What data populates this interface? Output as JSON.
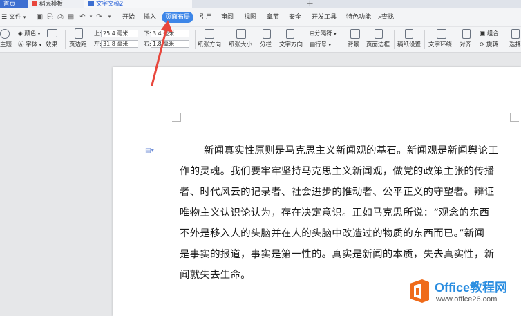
{
  "titlebar": {
    "tabs": [
      {
        "label": "首页",
        "active": false
      },
      {
        "label": "稻壳模板",
        "active": false
      },
      {
        "label": "文字文稿2",
        "active": true
      }
    ],
    "add_symbol": "+"
  },
  "menu": {
    "file_label": "文件",
    "items": [
      "开始",
      "插入",
      "页面布局",
      "引用",
      "审阅",
      "视图",
      "章节",
      "安全",
      "开发工具",
      "特色功能"
    ],
    "search_label": "查找"
  },
  "ribbon": {
    "theme": "主题",
    "color": "颜色",
    "font": "字体",
    "effect": "效果",
    "margin": "页边距",
    "margin_top_label": "上:",
    "margin_top_value": "25.4 毫米",
    "margin_left_label": "左:",
    "margin_left_value": "31.8 毫米",
    "margin_bottom_label": "下:",
    "margin_bottom_value": "3.4 毫米",
    "margin_right_label": "右:",
    "margin_right_value": "1.8 毫米",
    "orientation": "纸张方向",
    "size": "纸张大小",
    "columns": "分栏",
    "text_direction": "文字方向",
    "separator": "分隔符",
    "line_number": "行号",
    "background": "背景",
    "page_border": "页面边框",
    "manuscript": "稿纸设置",
    "text_wrap": "文字环绕",
    "align": "对齐",
    "group": "组合",
    "rotate": "旋转",
    "select_pane": "选择窗"
  },
  "document": {
    "lines": [
      "新闻真实性原则是马克思主义新闻观的基石。新闻观是新闻舆论工",
      "作的灵魂。我们要牢牢坚持马克思主义新闻观，做党的政策主张的传播",
      "者、时代风云的记录者、社会进步的推动者、公平正义的守望者。辩证",
      "唯物主义认识论认为，存在决定意识。正如马克思所说：“观念的东西",
      "不外是移入人的头脑并在人的头脑中改造过的物质的东西而已。”新闻",
      "是事实的报道，事实是第一性的。真实是新闻的本质，失去真实性，新",
      "闻就失去生命。"
    ]
  },
  "watermark": {
    "title": "Office教程网",
    "url": "www.office26.com"
  },
  "colors": {
    "accent": "#3d86e8",
    "arrow": "#e8463c",
    "watermark_orange": "#ef6b1a"
  }
}
